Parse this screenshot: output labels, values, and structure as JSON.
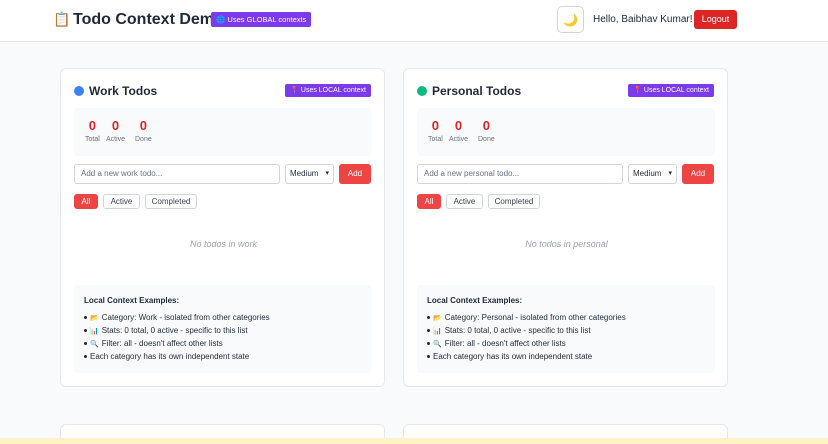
{
  "header": {
    "logo_icon": "📋",
    "title": "Todo Context Demo",
    "global_badge": "🌐 Uses GLOBAL contexts",
    "theme_icon": "🌙",
    "greeting": "Hello, Baibhav Kumar!",
    "logout_label": "Logout"
  },
  "colors": {
    "accent_red": "#ef4444",
    "badge_purple": "#7c3aed",
    "work_dot": "#3b82f6",
    "personal_dot": "#10b981"
  },
  "cards": {
    "work": {
      "title": "Work Todos",
      "badge": "📍 Uses LOCAL context",
      "stats": {
        "total": "0",
        "active": "0",
        "done": "0"
      },
      "stat_labels": {
        "total": "Total",
        "active": "Active",
        "done": "Done"
      },
      "input_placeholder": "Add a new work todo...",
      "priority": "Medium",
      "add_label": "Add",
      "filters": {
        "all": "All",
        "active": "Active",
        "completed": "Completed"
      },
      "empty_text": "No todos in work",
      "examples_title": "Local Context Examples:",
      "examples": [
        {
          "icon": "📂",
          "text": "Category: Work - isolated from other categories"
        },
        {
          "icon": "📊",
          "text": "Stats: 0 total, 0 active - specific to this list"
        },
        {
          "icon": "🔍",
          "text": "Filter: all - doesn't affect other lists"
        },
        {
          "icon": "",
          "text": "Each category has its own independent state"
        }
      ]
    },
    "personal": {
      "title": "Personal Todos",
      "badge": "📍 Uses LOCAL context",
      "stats": {
        "total": "0",
        "active": "0",
        "done": "0"
      },
      "stat_labels": {
        "total": "Total",
        "active": "Active",
        "done": "Done"
      },
      "input_placeholder": "Add a new personal todo...",
      "priority": "Medium",
      "add_label": "Add",
      "filters": {
        "all": "All",
        "active": "Active",
        "completed": "Completed"
      },
      "empty_text": "No todos in personal",
      "examples_title": "Local Context Examples:",
      "examples": [
        {
          "icon": "📂",
          "text": "Category: Personal - isolated from other categories"
        },
        {
          "icon": "📊",
          "text": "Stats: 0 total, 0 active - specific to this list"
        },
        {
          "icon": "🔍",
          "text": "Filter: all - doesn't affect other lists"
        },
        {
          "icon": "",
          "text": "Each category has its own independent state"
        }
      ]
    }
  }
}
